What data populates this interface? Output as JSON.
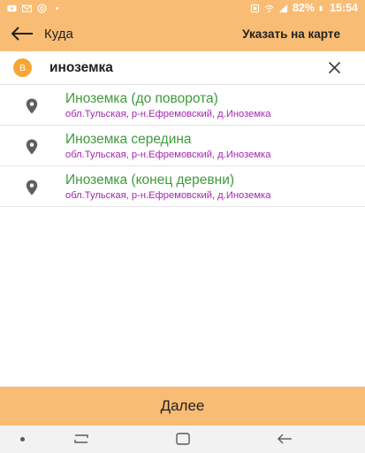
{
  "status_bar": {
    "battery": "82%",
    "time": "15:54",
    "left_icons": [
      "youtube-icon",
      "mail-icon",
      "at-icon",
      "more-dots-icon"
    ],
    "right_icons": [
      "nfc-icon",
      "wifi-icon",
      "signal-icon",
      "battery-icon"
    ]
  },
  "app_bar": {
    "back_icon": "arrow-left-icon",
    "title": "Куда",
    "map_link": "Указать на карте"
  },
  "search": {
    "badge": "B",
    "value": "иноземка",
    "clear_icon": "close-icon"
  },
  "results": [
    {
      "name": "Иноземка (до поворота)",
      "address": "обл.Тульская, р-н.Ефремовский, д.Иноземка",
      "icon": "location-pin-icon"
    },
    {
      "name": "Иноземка середина",
      "address": "обл.Тульская, р-н.Ефремовский, д.Иноземка",
      "icon": "location-pin-icon"
    },
    {
      "name": "Иноземка (конец деревни)",
      "address": "обл.Тульская, р-н.Ефремовский, д.Иноземка",
      "icon": "location-pin-icon"
    }
  ],
  "next_button": {
    "label": "Далее"
  },
  "nav_bar": {
    "icons": [
      "dot-icon",
      "recent-apps-icon",
      "home-icon",
      "back-icon"
    ]
  },
  "colors": {
    "accent": "#f9bc74",
    "badge": "#f7a632",
    "result_name": "#3e9b3c",
    "result_address": "#a526b3"
  }
}
